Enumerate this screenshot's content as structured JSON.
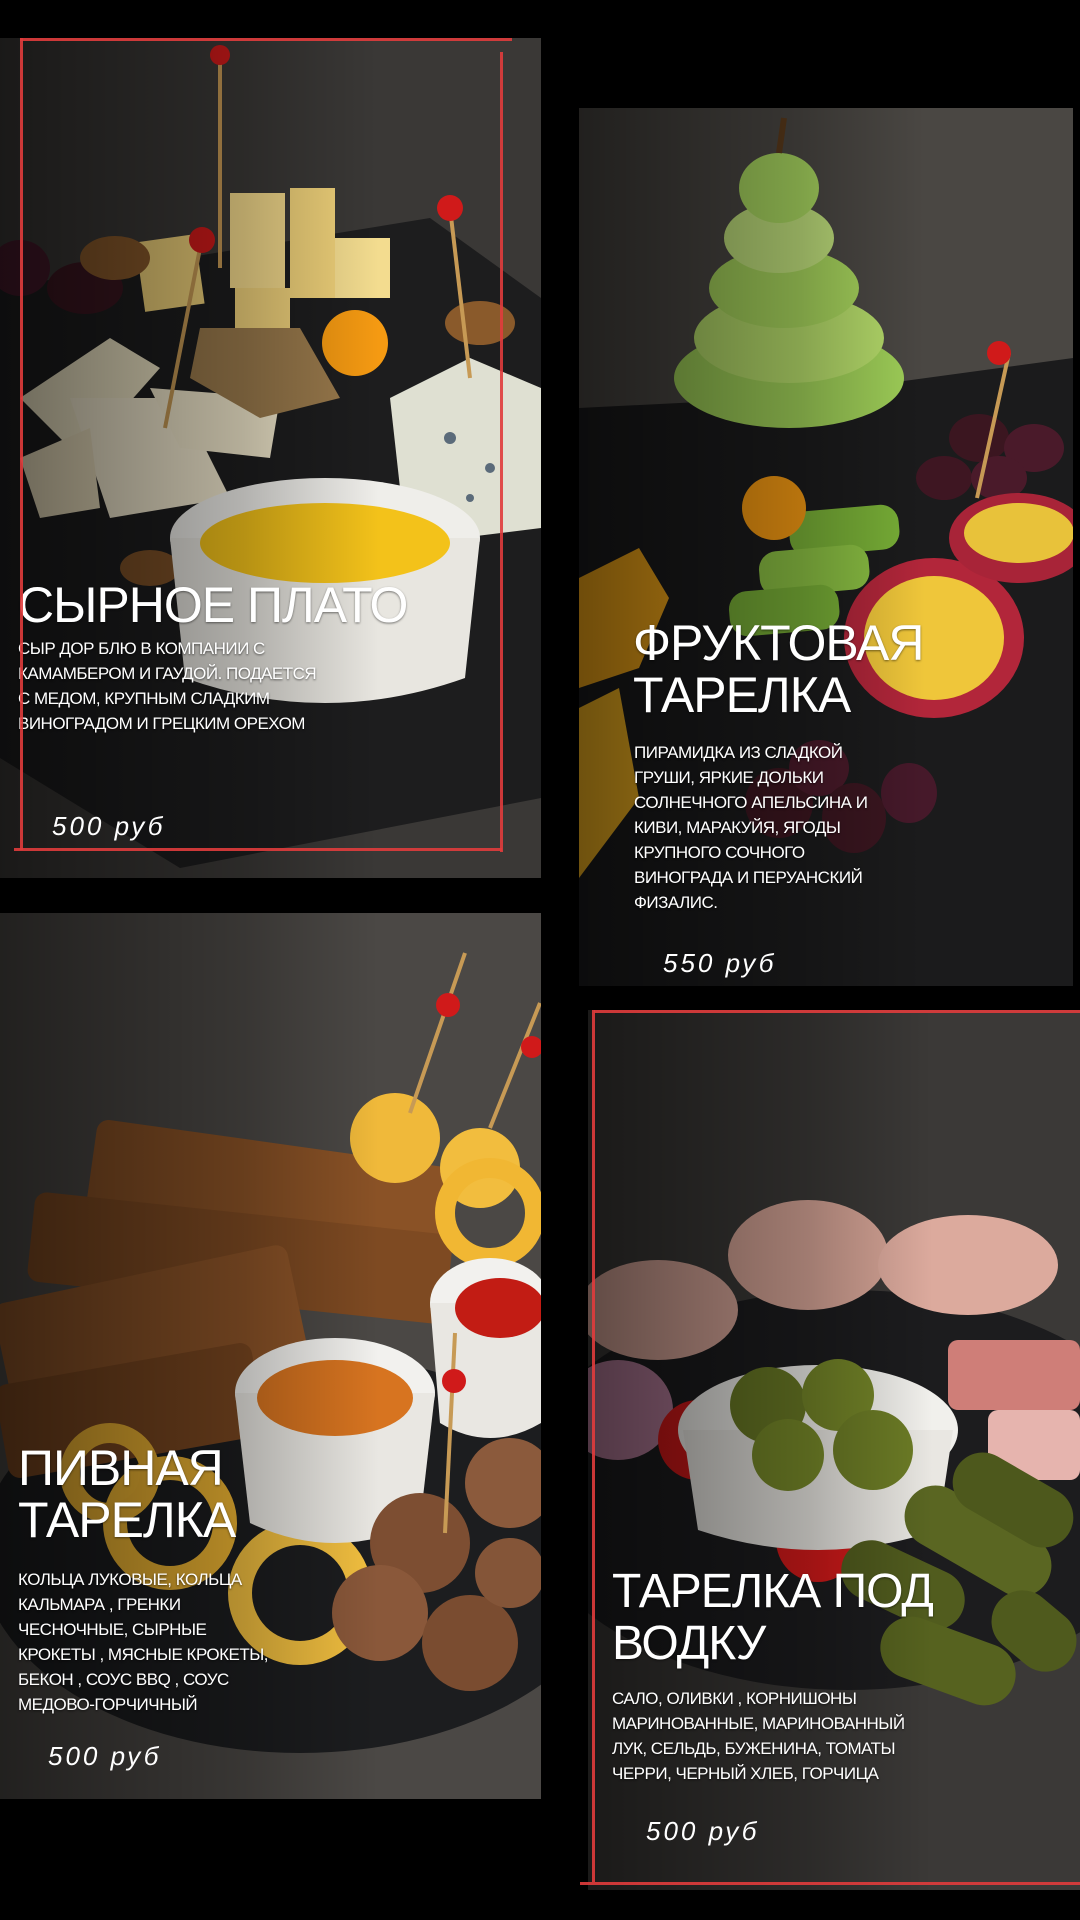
{
  "colors": {
    "background": "#000000",
    "accent": "#e03c3c",
    "text": "#ffffff"
  },
  "cards": [
    {
      "title": "СЫРНОЕ ПЛАТО",
      "description": "СЫР ДОР БЛЮ В КОМПАНИИ С КАМАМБЕРОМ И ГАУДОЙ. ПОДАЕТСЯ С МЕДОМ, КРУПНЫМ СЛАДКИМ ВИНОГРАДОМ И ГРЕЦКИМ ОРЕХОМ",
      "price": "500 руб"
    },
    {
      "title_line1": "ФРУКТОВАЯ",
      "title_line2": "ТАРЕЛКА",
      "description": "ПИРАМИДКА ИЗ СЛАДКОЙ ГРУШИ, ЯРКИЕ ДОЛЬКИ СОЛНЕЧНОГО АПЕЛЬСИНА И КИВИ, МАРАКУЙЯ, ЯГОДЫ КРУПНОГО СОЧНОГО ВИНОГРАДА И ПЕРУАНСКИЙ ФИЗАЛИС.",
      "price": "550 руб"
    },
    {
      "title_line1": "ПИВНАЯ",
      "title_line2": "ТАРЕЛКА",
      "description": "КОЛЬЦА ЛУКОВЫЕ, КОЛЬЦА КАЛЬМАРА , ГРЕНКИ ЧЕСНОЧНЫЕ, СЫРНЫЕ КРОКЕТЫ , МЯСНЫЕ КРОКЕТЫ, БЕКОН , СОУС BBQ , СОУС МЕДОВО-ГОРЧИЧНЫЙ",
      "price": "500 руб"
    },
    {
      "title_line1": "ТАРЕЛКА ПОД",
      "title_line2": "ВОДКУ",
      "description": "САЛО, ОЛИВКИ , КОРНИШОНЫ МАРИНОВАННЫЕ, МАРИНОВАННЫЙ ЛУК, СЕЛЬДЬ, БУЖЕНИНА, ТОМАТЫ ЧЕРРИ, ЧЕРНЫЙ ХЛЕБ, ГОРЧИЦА",
      "price": "500 руб"
    }
  ]
}
